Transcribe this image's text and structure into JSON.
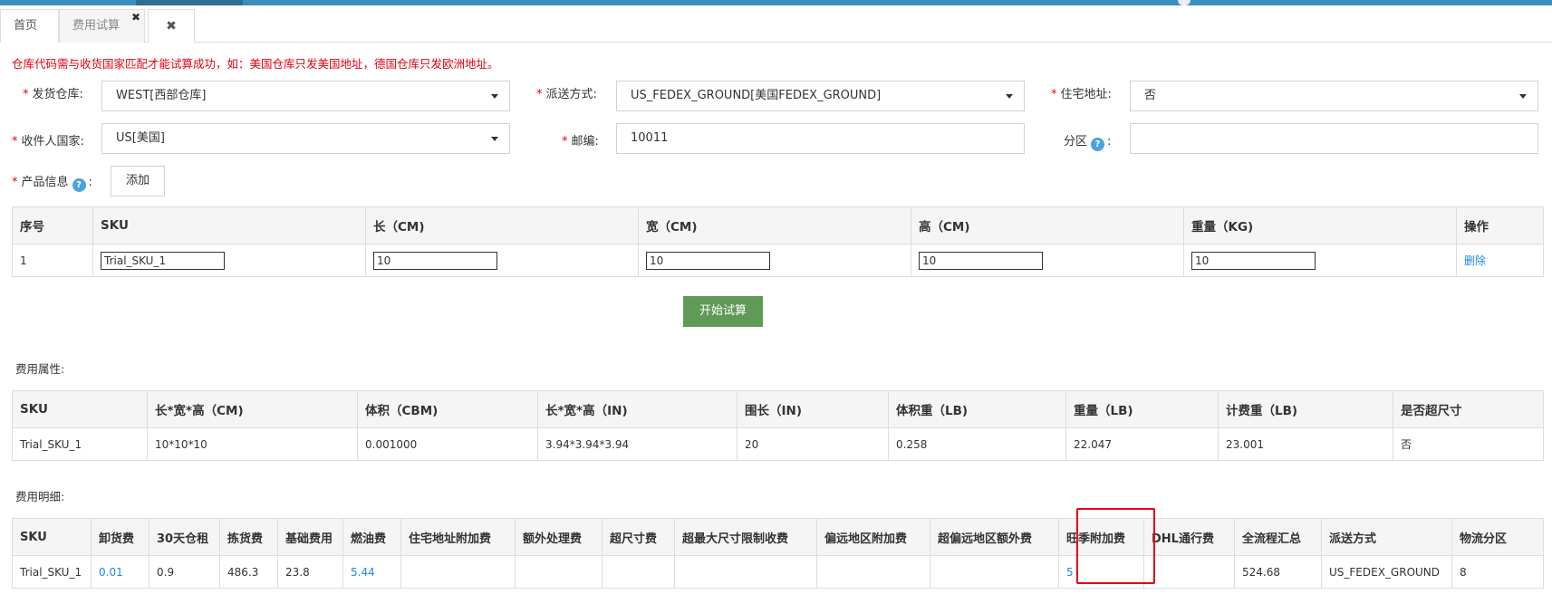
{
  "tabs": {
    "home": "首页",
    "active": "费用试算",
    "active_close": "✖",
    "close_all": "✖"
  },
  "notice": "仓库代码需与收货国家匹配才能试算成功，如：美国仓库只发美国地址，德国仓库只发欧洲地址。",
  "form": {
    "warehouse_label": "发货仓库:",
    "warehouse_value": "WEST[西部仓库]",
    "shipping_label": "派送方式:",
    "shipping_value": "US_FEDEX_GROUND[美国FEDEX_GROUND]",
    "residential_label": "住宅地址:",
    "residential_value": "否",
    "country_label": "收件人国家:",
    "country_value": "US[美国]",
    "zip_label": "邮编:",
    "zip_value": "10011",
    "zone_label": "分区",
    "zone_value": "",
    "product_label": "产品信息",
    "add_button": "添加",
    "required_mark": "*",
    "help_mark": "?",
    "colon": ":"
  },
  "product_table": {
    "headers": [
      "序号",
      "SKU",
      "长（CM)",
      "宽（CM)",
      "高（CM)",
      "重量（KG)",
      "操作"
    ],
    "rows": [
      {
        "index": "1",
        "sku": "Trial_SKU_1",
        "length": "10",
        "width": "10",
        "height": "10",
        "weight": "10",
        "action": "删除"
      }
    ]
  },
  "calc_button": "开始试算",
  "fee_attr": {
    "title": "费用属性:",
    "headers": [
      "SKU",
      "长*宽*高（CM)",
      "体积（CBM)",
      "长*宽*高（IN)",
      "围长（IN)",
      "体积重（LB)",
      "重量（LB)",
      "计费重（LB)",
      "是否超尺寸"
    ],
    "rows": [
      [
        "Trial_SKU_1",
        "10*10*10",
        "0.001000",
        "3.94*3.94*3.94",
        "20",
        "0.258",
        "22.047",
        "23.001",
        "否"
      ]
    ]
  },
  "fee_detail": {
    "title": "费用明细:",
    "headers": [
      "SKU",
      "卸货费",
      "30天仓租",
      "拣货费",
      "基础费用",
      "燃油费",
      "住宅地址附加费",
      "额外处理费",
      "超尺寸费",
      "超最大尺寸限制收费",
      "偏远地区附加费",
      "超偏远地区额外费",
      "旺季附加费",
      "DHL通行费",
      "全流程汇总",
      "派送方式",
      "物流分区"
    ],
    "rows": [
      [
        "Trial_SKU_1",
        "0.01",
        "0.9",
        "486.3",
        "23.8",
        "5.44",
        "",
        "",
        "",
        "",
        "",
        "",
        "5",
        "",
        "524.68",
        "US_FEDEX_GROUND",
        "8"
      ]
    ]
  },
  "colors": {
    "accent_blue": "#3c8dbc",
    "link_blue": "#1e88e5",
    "notice_red": "#e60012",
    "button_green": "#5f9a57"
  }
}
